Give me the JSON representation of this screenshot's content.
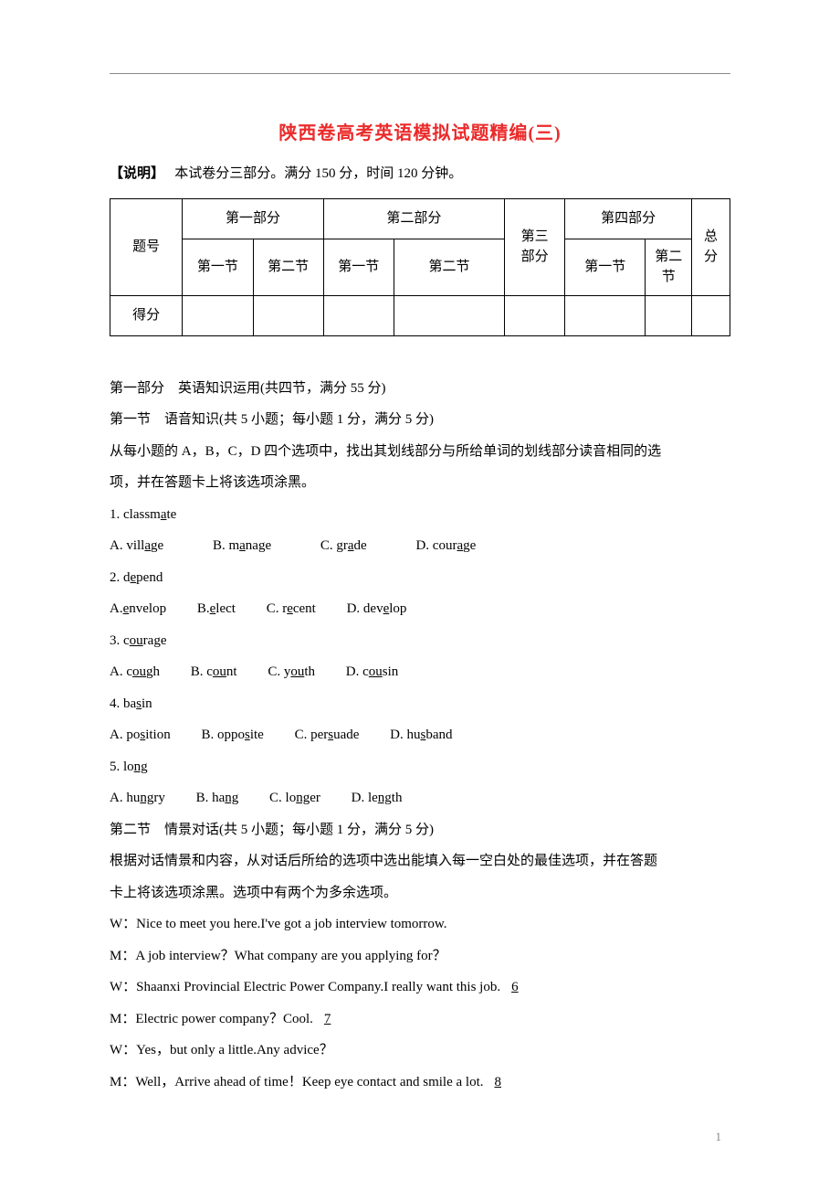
{
  "title": "陕西卷高考英语模拟试题精编(三)",
  "subtitle_label": "【说明】",
  "subtitle_text": "本试卷分三部分。满分 150 分，时间 120 分钟。",
  "table": {
    "row_label_1": "题号",
    "row_label_2": "得分",
    "part1": "第一部分",
    "part2": "第二部分",
    "part3_a": "第三",
    "part3_b": "部分",
    "part4": "第四部分",
    "total_a": "总",
    "total_b": "分",
    "sec1": "第一节",
    "sec2": "第二节",
    "sec2_a": "第二",
    "sec2_b": "节"
  },
  "part_intro": "第一部分　英语知识运用(共四节，满分 55 分)",
  "sec1_intro": "第一节　语音知识(共 5 小题；每小题 1 分，满分 5 分)",
  "sec1_instr_a": "从每小题的 A，B，C，D 四个选项中，找出其划线部分与所给单词的划线部分读音相同的选",
  "sec1_instr_b": "项，并在答题卡上将该选项涂黑。",
  "q1": {
    "stem_a": "1.  classm",
    "stem_u": "a",
    "stem_b": "te",
    "A_a": "A.  vill",
    "A_u": "a",
    "A_b": "ge",
    "B_a": "B.  m",
    "B_u": "a",
    "B_b": "nage",
    "C_a": "C.  gr",
    "C_u": "a",
    "C_b": "de",
    "D_a": "D.  cour",
    "D_u": "a",
    "D_b": "ge"
  },
  "q2": {
    "stem_a": "2.  d",
    "stem_u": "e",
    "stem_b": "pend",
    "A_a": "A.  ",
    "A_u": "e",
    "A_b": "nvelop",
    "B_a": "B.  ",
    "B_u": "e",
    "B_b": "lect",
    "C_a": "C.  r",
    "C_u": "e",
    "C_b": "cent",
    "D_a": "D.  dev",
    "D_u": "e",
    "D_b": "lop"
  },
  "q3": {
    "stem_a": "3.  c",
    "stem_u": "ou",
    "stem_b": "rage",
    "A_a": "A.  c",
    "A_u": "ou",
    "A_b": "gh",
    "B_a": "B.  c",
    "B_u": "ou",
    "B_b": "nt",
    "C_a": "C.  y",
    "C_u": "ou",
    "C_b": "th",
    "D_a": "D.  c",
    "D_u": "ou",
    "D_b": "sin"
  },
  "q4": {
    "stem_a": "4.  ba",
    "stem_u": "s",
    "stem_b": "in",
    "A_a": "A.  po",
    "A_u": "s",
    "A_b": "ition",
    "B_a": "B.  oppo",
    "B_u": "s",
    "B_b": "ite",
    "C_a": "C.  per",
    "C_u": "s",
    "C_b": "uade",
    "D_a": "D.  hu",
    "D_u": "s",
    "D_b": "band"
  },
  "q5": {
    "stem_a": "5.  lo",
    "stem_u": "ng",
    "stem_b": "",
    "A_a": "A.  hu",
    "A_u": "ng",
    "A_b": "ry",
    "B_a": "B.  ha",
    "B_u": "ng",
    "B_b": "",
    "C_a": "C.  lo",
    "C_u": "ng",
    "C_b": "er",
    "D_a": "D.  le",
    "D_u": "ng",
    "D_b": "th"
  },
  "sec2_intro": "第二节　情景对话(共 5 小题；每小题 1 分，满分 5 分)",
  "sec2_instr_a": "根据对话情景和内容，从对话后所给的选项中选出能填入每一空白处的最佳选项，并在答题",
  "sec2_instr_b": "卡上将该选项涂黑。选项中有两个为多余选项。",
  "d1": "W：Nice to meet you here.I've got a job interview tomorrow.",
  "d2": "M：A job interview？What company are you applying for？",
  "d3_a": "W：Shaanxi Provincial Electric Power Company.I really want this job.",
  "d3_blank": "6",
  "d4_a": "M：Electric power company？Cool.",
  "d4_blank": "7",
  "d5": "W：Yes，but only a little.Any advice？",
  "d6_a": "M：Well，Arrive ahead of time！Keep eye contact and smile a lot.",
  "d6_blank": "8",
  "page_num": "1"
}
